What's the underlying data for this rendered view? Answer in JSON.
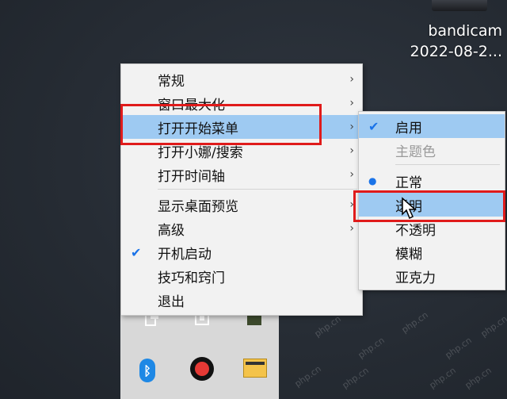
{
  "desktop": {
    "icon_name": "bandicam",
    "icon_date": "2022-08-2..."
  },
  "main_menu": {
    "items": [
      {
        "label": "常规",
        "arrow": "›"
      },
      {
        "label": "窗口最大化",
        "arrow": "›"
      },
      {
        "label": "打开开始菜单",
        "arrow": "›"
      },
      {
        "label": "打开小娜/搜索",
        "arrow": "›"
      },
      {
        "label": "打开时间轴",
        "arrow": "›"
      },
      {
        "label": "显示桌面预览",
        "arrow": "›"
      },
      {
        "label": "高级",
        "arrow": "›"
      },
      {
        "label": "开机启动",
        "check": "✔"
      },
      {
        "label": "技巧和窍门"
      },
      {
        "label": "退出"
      }
    ]
  },
  "sub_menu": {
    "items": [
      {
        "label": "启用",
        "check": "✔"
      },
      {
        "label": "主题色"
      },
      {
        "label": "正常",
        "bullet": "●"
      },
      {
        "label": "透明"
      },
      {
        "label": "不透明"
      },
      {
        "label": "模糊"
      },
      {
        "label": "亚克力"
      }
    ]
  },
  "tiles": {
    "bluetooth_glyph": "ᛒ"
  },
  "watermark_text": "php.cn",
  "colors": {
    "highlight": "#9ecaf2",
    "annotation_red": "#e01b1b",
    "check_blue": "#1a73e8"
  }
}
